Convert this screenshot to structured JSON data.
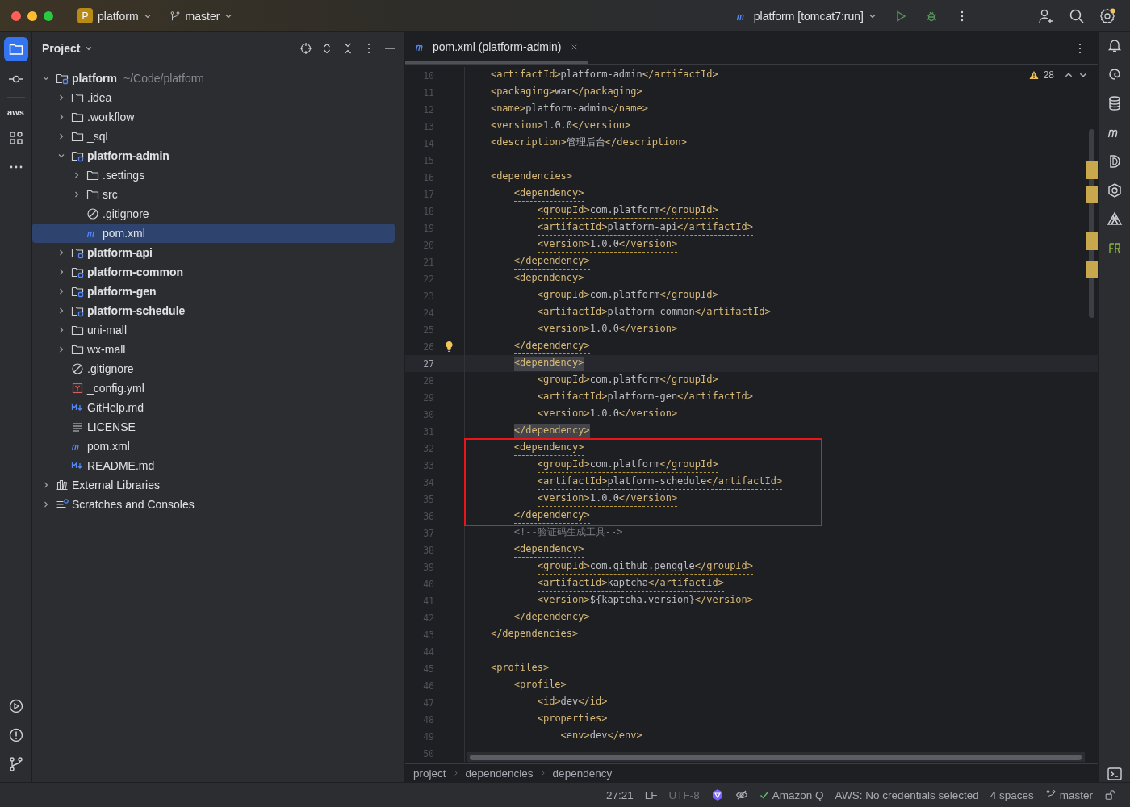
{
  "title_bar": {
    "project_badge": "P",
    "project": "platform",
    "branch": "master",
    "run_config": "platform [tomcat7:run]"
  },
  "left_toolbar": {
    "aws_label": "aws"
  },
  "project_panel": {
    "title": "Project",
    "tree": [
      {
        "name": "platform",
        "hint": "~/Code/platform",
        "kind": "module",
        "expanded": true,
        "selected": false,
        "children": [
          {
            "name": ".idea",
            "kind": "folder",
            "expanded": false,
            "selected": false
          },
          {
            "name": ".workflow",
            "kind": "folder",
            "expanded": false,
            "selected": false
          },
          {
            "name": "_sql",
            "kind": "folder",
            "expanded": false,
            "selected": false
          },
          {
            "name": "platform-admin",
            "kind": "module",
            "expanded": true,
            "selected": false,
            "children": [
              {
                "name": ".settings",
                "kind": "folder",
                "expanded": false,
                "selected": false
              },
              {
                "name": "src",
                "kind": "folder",
                "expanded": false,
                "selected": false
              },
              {
                "name": ".gitignore",
                "kind": "ignore",
                "selected": false
              },
              {
                "name": "pom.xml",
                "kind": "maven",
                "selected": true
              }
            ]
          },
          {
            "name": "platform-api",
            "kind": "module",
            "expanded": false,
            "selected": false
          },
          {
            "name": "platform-common",
            "kind": "module",
            "expanded": false,
            "selected": false
          },
          {
            "name": "platform-gen",
            "kind": "module",
            "expanded": false,
            "selected": false
          },
          {
            "name": "platform-schedule",
            "kind": "module",
            "expanded": false,
            "selected": false
          },
          {
            "name": "uni-mall",
            "kind": "folder",
            "expanded": false,
            "selected": false
          },
          {
            "name": "wx-mall",
            "kind": "folder",
            "expanded": false,
            "selected": false
          },
          {
            "name": ".gitignore",
            "kind": "ignore",
            "selected": false
          },
          {
            "name": "_config.yml",
            "kind": "yml",
            "selected": false
          },
          {
            "name": "GitHelp.md",
            "kind": "md",
            "selected": false
          },
          {
            "name": "LICENSE",
            "kind": "text",
            "selected": false
          },
          {
            "name": "pom.xml",
            "kind": "maven",
            "selected": false
          },
          {
            "name": "README.md",
            "kind": "md",
            "selected": false
          }
        ]
      },
      {
        "name": "External Libraries",
        "kind": "library",
        "expanded": false,
        "selected": false
      },
      {
        "name": "Scratches and Consoles",
        "kind": "scratch",
        "expanded": false,
        "selected": false
      }
    ]
  },
  "editor": {
    "tabs": [
      {
        "label": "pom.xml (platform-admin)",
        "selected": true
      }
    ],
    "warning_count": "28",
    "lines": [
      {
        "kind": "line",
        "n": "10",
        "code": "    <artifactId>platform-admin</artifactId>",
        "warning": false,
        "current": false,
        "match": false
      },
      {
        "kind": "line",
        "n": "11",
        "code": "    <packaging>war</packaging>",
        "warning": false,
        "current": false,
        "match": false
      },
      {
        "kind": "line",
        "n": "12",
        "code": "    <name>platform-admin</name>",
        "warning": false,
        "current": false,
        "match": false
      },
      {
        "kind": "line",
        "n": "13",
        "code": "    <version>1.0.0</version>",
        "warning": false,
        "current": false,
        "match": false
      },
      {
        "kind": "line",
        "n": "14",
        "code": "    <description>管理后台</description>",
        "warning": false,
        "current": false,
        "match": false
      },
      {
        "kind": "line",
        "n": "15",
        "current": false
      },
      {
        "kind": "line",
        "n": "16",
        "code": "    <dependencies>",
        "warning": false,
        "current": false,
        "match": false
      },
      {
        "kind": "line",
        "n": "17",
        "code": "        <dependency>",
        "warning": true,
        "current": false,
        "match": false
      },
      {
        "kind": "line",
        "n": "18",
        "code": "            <groupId>com.platform</groupId>",
        "warning": true,
        "current": false,
        "match": false
      },
      {
        "kind": "line",
        "n": "19",
        "code": "            <artifactId>platform-api</artifactId>",
        "warning": true,
        "current": false,
        "match": false
      },
      {
        "kind": "line",
        "n": "20",
        "code": "            <version>1.0.0</version>",
        "warning": true,
        "current": false,
        "match": false
      },
      {
        "kind": "line",
        "n": "21",
        "code": "        </dependency>",
        "warning": true,
        "current": false,
        "match": false
      },
      {
        "kind": "line",
        "n": "22",
        "code": "        <dependency>",
        "warning": true,
        "current": false,
        "match": false
      },
      {
        "kind": "line",
        "n": "23",
        "code": "            <groupId>com.platform</groupId>",
        "warning": true,
        "current": false,
        "match": false
      },
      {
        "kind": "line",
        "n": "24",
        "code": "            <artifactId>platform-common</artifactId>",
        "warning": true,
        "current": false,
        "match": false
      },
      {
        "kind": "line",
        "n": "25",
        "code": "            <version>1.0.0</version>",
        "warning": true,
        "current": false,
        "match": false
      },
      {
        "kind": "line",
        "n": "26",
        "code": "        </dependency>",
        "warning": true,
        "current": false,
        "match": false,
        "bulb": true
      },
      {
        "kind": "line",
        "n": "27",
        "code": "        <dependency>",
        "warning": false,
        "current": true,
        "match": true
      },
      {
        "kind": "line",
        "n": "28",
        "code": "            <groupId>com.platform</groupId>",
        "warning": false,
        "current": false,
        "match": false
      },
      {
        "kind": "line",
        "n": "29",
        "code": "            <artifactId>platform-gen</artifactId>",
        "warning": false,
        "current": false,
        "match": false
      },
      {
        "kind": "line",
        "n": "30",
        "code": "            <version>1.0.0</version>",
        "warning": false,
        "current": false,
        "match": false
      },
      {
        "kind": "line",
        "n": "31",
        "code": "        </dependency>",
        "warning": false,
        "current": false,
        "match": true
      },
      {
        "kind": "highlight_box",
        "lines": [
          {
            "n": "32",
            "code": "        <dependency>",
            "warning": true,
            "current": false,
            "match": false
          },
          {
            "n": "33",
            "code": "            <groupId>com.platform</groupId>",
            "warning": true,
            "current": false,
            "match": false
          },
          {
            "n": "34",
            "code": "            <artifactId>platform-schedule</artifactId>",
            "warning": true,
            "current": false,
            "match": false
          },
          {
            "n": "35",
            "code": "            <version>1.0.0</version>",
            "warning": true,
            "current": false,
            "match": false
          },
          {
            "n": "36",
            "code": "        </dependency>",
            "warning": true,
            "current": false,
            "match": false
          }
        ]
      },
      {
        "kind": "line",
        "n": "37",
        "code": "        <!--验证码生成工具-->",
        "warning": false,
        "current": false,
        "match": false
      },
      {
        "kind": "line",
        "n": "38",
        "code": "        <dependency>",
        "warning": true,
        "current": false,
        "match": false
      },
      {
        "kind": "line",
        "n": "39",
        "code": "            <groupId>com.github.penggle</groupId>",
        "warning": true,
        "current": false,
        "match": false
      },
      {
        "kind": "line",
        "n": "40",
        "code": "            <artifactId>kaptcha</artifactId>",
        "warning": true,
        "current": false,
        "match": false
      },
      {
        "kind": "line",
        "n": "41",
        "code": "            <version>${kaptcha.version}</version>",
        "warning": true,
        "current": false,
        "match": false
      },
      {
        "kind": "line",
        "n": "42",
        "code": "        </dependency>",
        "warning": true,
        "current": false,
        "match": false
      },
      {
        "kind": "line",
        "n": "43",
        "code": "    </dependencies>",
        "warning": false,
        "current": false,
        "match": false
      },
      {
        "kind": "line",
        "n": "44",
        "current": false
      },
      {
        "kind": "line",
        "n": "45",
        "code": "    <profiles>",
        "warning": false,
        "current": false,
        "match": false
      },
      {
        "kind": "line",
        "n": "46",
        "code": "        <profile>",
        "warning": false,
        "current": false,
        "match": false
      },
      {
        "kind": "line",
        "n": "47",
        "code": "            <id>dev</id>",
        "warning": false,
        "current": false,
        "match": false
      },
      {
        "kind": "line",
        "n": "48",
        "code": "            <properties>",
        "warning": false,
        "current": false,
        "match": false
      },
      {
        "kind": "line",
        "n": "49",
        "code": "                <env>dev</env>",
        "warning": false,
        "current": false,
        "match": false
      },
      {
        "kind": "line",
        "n": "50",
        "current": false
      }
    ],
    "breadcrumbs": [
      "project",
      "dependencies",
      "dependency"
    ]
  },
  "status_bar": {
    "position": "27:21",
    "line_separator": "LF",
    "encoding": "UTF-8",
    "amazon_q": "Amazon Q",
    "aws": "AWS: No credentials selected",
    "indent": "4 spaces",
    "branch": "master"
  }
}
